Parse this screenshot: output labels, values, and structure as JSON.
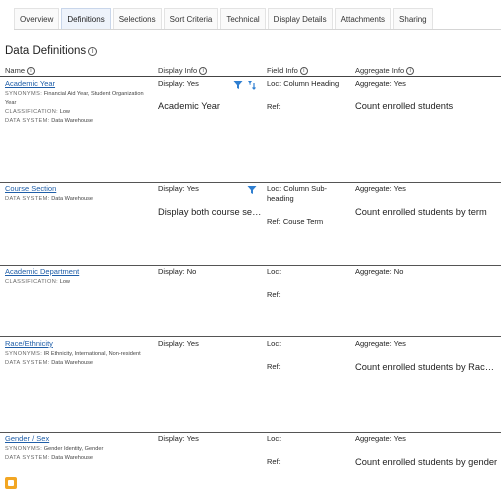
{
  "tabs": [
    "Overview",
    "Definitions",
    "Selections",
    "Sort Criteria",
    "Technical",
    "Display Details",
    "Attachments",
    "Sharing"
  ],
  "active_tab": "Definitions",
  "section_title": "Data Definitions",
  "columns": {
    "name": "Name",
    "display": "Display Info",
    "field": "Field Info",
    "aggregate": "Aggregate Info"
  },
  "labels": {
    "synonyms": "SYNONYMS:",
    "classification": "CLASSIFICATION:",
    "data_system": "DATA SYSTEM:",
    "ref": "Ref:"
  },
  "rows": [
    {
      "name": "Academic Year",
      "synonyms": "Financial Aid Year, Student Organization Year",
      "classification": "Low",
      "data_system": "Data Warehouse",
      "display": "Display: Yes",
      "display_text": "Academic Year",
      "loc": "Loc: Column Heading",
      "ref": "Ref:",
      "aggregate": "Aggregate: Yes",
      "aggregate_text": "Count enrolled students",
      "icons": [
        "filter-icon",
        "sort-icon"
      ]
    },
    {
      "name": "Course Section",
      "data_system": "Data Warehouse",
      "display": "Display: Yes",
      "display_text": "Display both course sec...",
      "loc": "Loc: Column Sub-heading",
      "ref": "Ref: Couse Term",
      "aggregate": "Aggregate: Yes",
      "aggregate_text": "Count enrolled students by term",
      "icons": [
        "filter-icon"
      ]
    },
    {
      "name": "Academic Department",
      "classification": "Low",
      "display": "Display: No",
      "loc": "Loc:",
      "ref": "Ref:",
      "aggregate": "Aggregate: No"
    },
    {
      "name": "Race/Ethnicity",
      "synonyms": "IR Ethnicity, International, Non-resident",
      "data_system": "Data Warehouse",
      "display": "Display: Yes",
      "loc": "Loc:",
      "ref": "Ref:",
      "aggregate": "Aggregate: Yes",
      "aggregate_text": "Count enrolled students by Race/..."
    },
    {
      "name": "Gender / Sex",
      "synonyms": "Gender Identity, Gender",
      "data_system": "Data Warehouse",
      "display": "Display: Yes",
      "loc": "Loc:",
      "ref": "Ref:",
      "aggregate": "Aggregate: Yes",
      "aggregate_text": "Count enrolled students by gender"
    }
  ],
  "icon_colors": {
    "filter": "#2f7fd1",
    "sort": "#2f7fd1",
    "bottom_badge": "#f2a623"
  }
}
